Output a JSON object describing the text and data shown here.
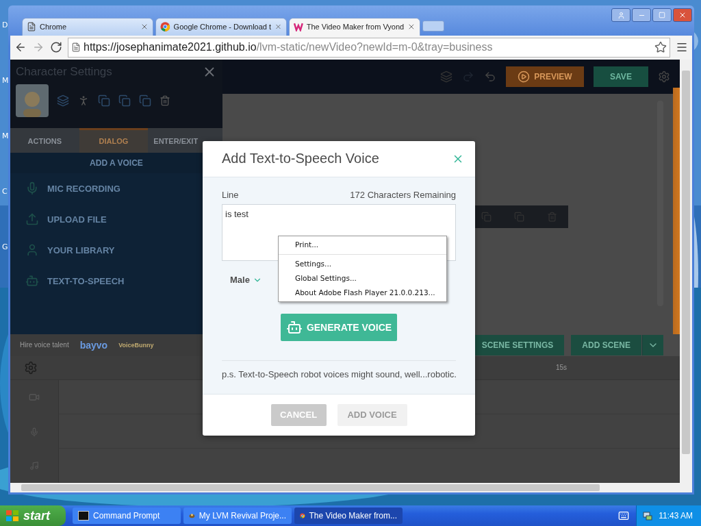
{
  "desktop": {
    "edge_labels": [
      "D",
      "M",
      "M",
      "C",
      "G"
    ]
  },
  "browser": {
    "tabs": [
      {
        "title": "Chrome",
        "kind": "page",
        "selected": false
      },
      {
        "title": "Google Chrome - Download t",
        "kind": "chrome",
        "selected": false
      },
      {
        "title": "The Video Maker from Vyond",
        "kind": "vyond",
        "selected": true
      }
    ],
    "url": {
      "host": "https://josephanimate2021.github.io",
      "path": "/lvm-static/newVideo?newId=m-0&tray=business"
    }
  },
  "app": {
    "toolbar": {
      "preview": "PREVIEW",
      "save": "SAVE"
    },
    "character_panel": {
      "title": "Character Settings",
      "tabs": [
        {
          "label": "ACTIONS",
          "selected": false
        },
        {
          "label": "DIALOG",
          "selected": true
        },
        {
          "label": "ENTER/EXIT",
          "selected": false
        }
      ],
      "section_title": "ADD A VOICE",
      "options": [
        {
          "label": "MIC RECORDING",
          "kind": "mic"
        },
        {
          "label": "UPLOAD FILE",
          "kind": "upload"
        },
        {
          "label": "YOUR LIBRARY",
          "kind": "library"
        },
        {
          "label": "TEXT-TO-SPEECH",
          "kind": "tts"
        }
      ],
      "hire_label": "Hire voice talent",
      "partners": [
        "bayvo",
        "VoiceBunny"
      ]
    },
    "scene_buttons": [
      "SCENE SETTINGS",
      "ADD SCENE"
    ],
    "timeline": {
      "time_mark": "15s"
    }
  },
  "dialog": {
    "title": "Add Text-to-Speech Voice",
    "line_label": "Line",
    "remaining": "172 Characters Remaining",
    "line_value": "is test",
    "voice": "Male",
    "generate": "GENERATE VOICE",
    "note": "p.s. Text-to-Speech robot voices might sound, well...robotic.",
    "buttons": [
      {
        "label": "CANCEL",
        "kind": "secondary",
        "disabled": false
      },
      {
        "label": "ADD VOICE",
        "kind": "primary",
        "disabled": true
      }
    ]
  },
  "context_menu": {
    "groups": [
      [
        "Print..."
      ],
      [
        "Settings...",
        "Global Settings...",
        "About Adobe Flash Player 21.0.0.213..."
      ]
    ]
  },
  "taskbar": {
    "start": "start",
    "tasks": [
      {
        "title": "Command Prompt",
        "kind": "cmd",
        "selected": false
      },
      {
        "title": "My LVM Revival Proje...",
        "kind": "app",
        "selected": false
      },
      {
        "title": "The Video Maker from...",
        "kind": "chrome",
        "selected": true
      }
    ],
    "clock": "11:43 AM"
  }
}
